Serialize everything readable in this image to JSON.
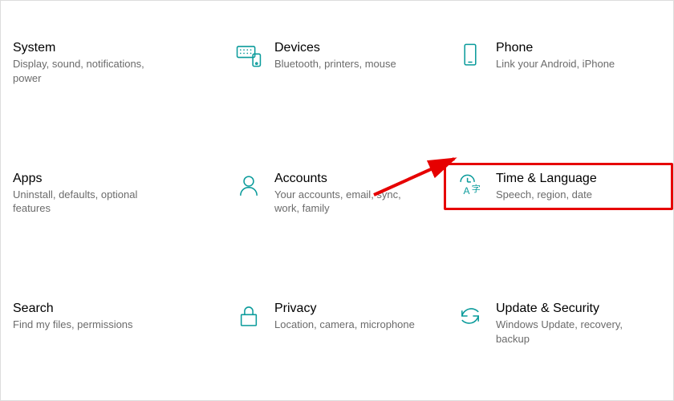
{
  "accent": "#0a9b9b",
  "highlight": "#e60000",
  "items": [
    {
      "id": "system",
      "title": "System",
      "subtitle": "Display, sound, notifications, power",
      "icon": null
    },
    {
      "id": "devices",
      "title": "Devices",
      "subtitle": "Bluetooth, printers, mouse",
      "icon": "keyboard-icon"
    },
    {
      "id": "phone",
      "title": "Phone",
      "subtitle": "Link your Android, iPhone",
      "icon": "phone-icon"
    },
    {
      "id": "apps",
      "title": "Apps",
      "subtitle": "Uninstall, defaults, optional features",
      "icon": null
    },
    {
      "id": "accounts",
      "title": "Accounts",
      "subtitle": "Your accounts, email, sync, work, family",
      "icon": "person-icon"
    },
    {
      "id": "time-language",
      "title": "Time & Language",
      "subtitle": "Speech, region, date",
      "icon": "time-language-icon",
      "highlighted": true
    },
    {
      "id": "search",
      "title": "Search",
      "subtitle": "Find my files, permissions",
      "icon": null
    },
    {
      "id": "privacy",
      "title": "Privacy",
      "subtitle": "Location, camera, microphone",
      "icon": "lock-icon"
    },
    {
      "id": "update-security",
      "title": "Update & Security",
      "subtitle": "Windows Update, recovery, backup",
      "icon": "sync-icon"
    }
  ]
}
